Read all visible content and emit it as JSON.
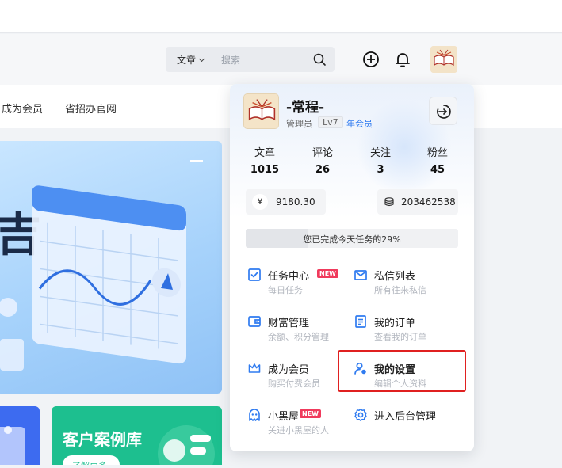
{
  "search": {
    "type_label": "文章",
    "placeholder": "搜索"
  },
  "nav": {
    "items": [
      "成为会员",
      "省招办官网"
    ]
  },
  "content": {
    "green_card_title": "客户案例库",
    "green_card_button": "了解更多"
  },
  "user_menu": {
    "name": "-常程-",
    "role": "管理员",
    "level": "Lv7",
    "membership": "年会员",
    "stats": [
      {
        "label": "文章",
        "value": "1015"
      },
      {
        "label": "评论",
        "value": "26"
      },
      {
        "label": "关注",
        "value": "3"
      },
      {
        "label": "粉丝",
        "value": "45"
      }
    ],
    "balance": {
      "symbol": "¥",
      "value": "9180.30"
    },
    "points": {
      "value": "203462538"
    },
    "task_progress": {
      "text": "您已完成今天任务的29%",
      "percent": 29
    },
    "items": [
      {
        "title": "任务中心",
        "subtitle": "每日任务",
        "badge": "NEW",
        "icon": "checkbox-icon"
      },
      {
        "title": "私信列表",
        "subtitle": "所有往来私信",
        "icon": "mail-icon"
      },
      {
        "title": "财富管理",
        "subtitle": "余额、积分管理",
        "icon": "wallet-icon"
      },
      {
        "title": "我的订单",
        "subtitle": "查看我的订单",
        "icon": "order-icon"
      },
      {
        "title": "成为会员",
        "subtitle": "购买付费会员",
        "icon": "crown-icon"
      },
      {
        "title": "我的设置",
        "subtitle": "编辑个人资料",
        "icon": "user-settings-icon"
      },
      {
        "title": "小黑屋",
        "subtitle": "关进小黑屋的人",
        "badge": "NEW",
        "icon": "ghost-icon"
      },
      {
        "title": "进入后台管理",
        "subtitle": "",
        "icon": "gear-icon"
      }
    ]
  },
  "colors": {
    "accent": "#2f7bf0",
    "badge": "#f03a5c",
    "highlight": "#e02020"
  }
}
